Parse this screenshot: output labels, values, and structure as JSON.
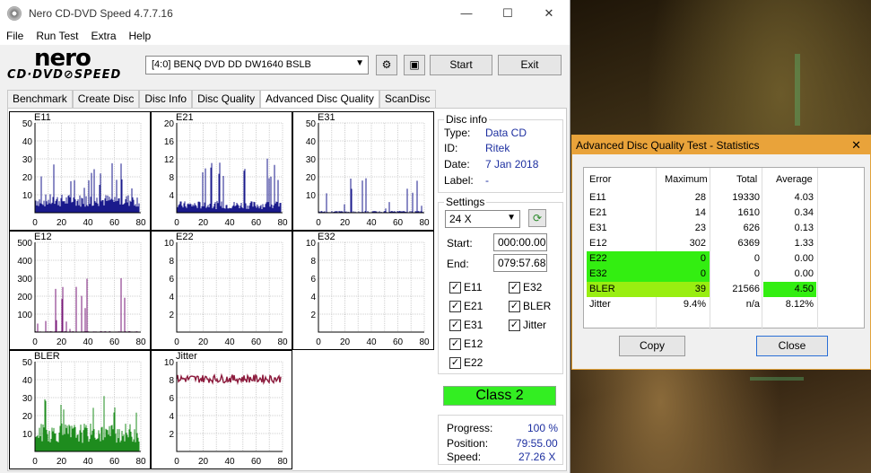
{
  "window": {
    "title": "Nero CD-DVD Speed 4.7.7.16",
    "min": "—",
    "max": "☐",
    "close": "✕"
  },
  "menu": [
    "File",
    "Run Test",
    "Extra",
    "Help"
  ],
  "logo": {
    "line1": "nero",
    "line2": "CD·DVD⊘SPEED"
  },
  "toolbar": {
    "drive": "[4:0]   BENQ DVD DD DW1640 BSLB",
    "start": "Start",
    "exit": "Exit"
  },
  "tabs": [
    "Benchmark",
    "Create Disc",
    "Disc Info",
    "Disc Quality",
    "Advanced Disc Quality",
    "ScanDisc"
  ],
  "disc_info": {
    "heading": "Disc info",
    "rows": [
      {
        "label": "Type:",
        "value": "Data CD"
      },
      {
        "label": "ID:",
        "value": "Ritek"
      },
      {
        "label": "Date:",
        "value": "7 Jan 2018"
      },
      {
        "label": "Label:",
        "value": "-"
      }
    ]
  },
  "settings": {
    "heading": "Settings",
    "speed": "24 X",
    "start_label": "Start:",
    "start": "000:00.00",
    "end_label": "End:",
    "end": "079:57.68",
    "checks": [
      {
        "label": "E11",
        "checked": "✓"
      },
      {
        "label": "E32",
        "checked": "✓"
      },
      {
        "label": "E21",
        "checked": "✓"
      },
      {
        "label": "BLER",
        "checked": "✓"
      },
      {
        "label": "E31",
        "checked": "✓"
      },
      {
        "label": "Jitter",
        "checked": "✓"
      },
      {
        "label": "E12",
        "checked": "✓"
      },
      {
        "label": "E22",
        "checked": "✓"
      }
    ]
  },
  "class_label": "Class 2",
  "progress": {
    "progress_label": "Progress:",
    "progress": "100 %",
    "position_label": "Position:",
    "position": "79:55.00",
    "speed_label": "Speed:",
    "speed": "27.26 X"
  },
  "charts": [
    {
      "name": "E11",
      "yticks": [
        "50",
        "40",
        "30",
        "20",
        "10"
      ],
      "xticks": [
        "0",
        "20",
        "40",
        "60",
        "80"
      ],
      "ymax": 50,
      "color": "#1a1a8c",
      "chart_data": {
        "type": "bar",
        "x": [
          0,
          80
        ],
        "summary_max": 28,
        "typical": 8
      }
    },
    {
      "name": "E21",
      "yticks": [
        "20",
        "16",
        "12",
        "8",
        "4"
      ],
      "xticks": [
        "0",
        "20",
        "40",
        "60",
        "80"
      ],
      "ymax": 20,
      "color": "#1a1a8c",
      "chart_data": {
        "type": "bar",
        "x": [
          0,
          80
        ],
        "summary_max": 14,
        "typical": 2
      }
    },
    {
      "name": "E31",
      "yticks": [
        "50",
        "40",
        "30",
        "20",
        "10"
      ],
      "xticks": [
        "0",
        "20",
        "40",
        "60",
        "80"
      ],
      "ymax": 50,
      "color": "#1a1a8c",
      "chart_data": {
        "type": "bar",
        "x": [
          0,
          80
        ],
        "summary_max": 23,
        "typical": 1
      }
    },
    {
      "name": "E12",
      "yticks": [
        "500",
        "400",
        "300",
        "200",
        "100"
      ],
      "xticks": [
        "0",
        "20",
        "40",
        "60",
        "80"
      ],
      "ymax": 500,
      "color": "#7a1a7a",
      "chart_data": {
        "type": "bar",
        "x": [
          0,
          80
        ],
        "summary_max": 302,
        "typical": 5
      }
    },
    {
      "name": "E22",
      "yticks": [
        "10",
        "8",
        "6",
        "4",
        "2"
      ],
      "xticks": [
        "0",
        "20",
        "40",
        "60",
        "80"
      ],
      "ymax": 10,
      "color": "#1a1a8c",
      "chart_data": {
        "type": "bar",
        "x": [
          0,
          80
        ],
        "summary_max": 0,
        "typical": 0
      }
    },
    {
      "name": "E32",
      "yticks": [
        "10",
        "8",
        "6",
        "4",
        "2"
      ],
      "xticks": [
        "0",
        "20",
        "40",
        "60",
        "80"
      ],
      "ymax": 10,
      "color": "#1a1a8c",
      "chart_data": {
        "type": "bar",
        "x": [
          0,
          80
        ],
        "summary_max": 0,
        "typical": 0
      }
    },
    {
      "name": "BLER",
      "yticks": [
        "50",
        "40",
        "30",
        "20",
        "10"
      ],
      "xticks": [
        "0",
        "20",
        "40",
        "60",
        "80"
      ],
      "ymax": 50,
      "color": "#1e8c1e",
      "chart_data": {
        "type": "bar",
        "x": [
          0,
          80
        ],
        "summary_max": 39,
        "typical": 12
      }
    },
    {
      "name": "Jitter",
      "yticks": [
        "10",
        "8",
        "6",
        "4",
        "2"
      ],
      "xticks": [
        "0",
        "20",
        "40",
        "60",
        "80"
      ],
      "ymax": 10,
      "color": "#8c1a3c",
      "chart_data": {
        "type": "line",
        "x": [
          0,
          80
        ],
        "level": 8.1
      }
    }
  ],
  "dialog": {
    "title": "Advanced Disc Quality Test - Statistics",
    "headers": [
      "Error",
      "Maximum",
      "Total",
      "Average"
    ],
    "rows": [
      [
        "E11",
        "28",
        "19330",
        "4.03"
      ],
      [
        "E21",
        "14",
        "1610",
        "0.34"
      ],
      [
        "E31",
        "23",
        "626",
        "0.13"
      ],
      [
        "E12",
        "302",
        "6369",
        "1.33"
      ],
      [
        "E22",
        "0",
        "0",
        "0.00"
      ],
      [
        "E32",
        "0",
        "0",
        "0.00"
      ],
      [
        "BLER",
        "39",
        "21566",
        "4.50"
      ],
      [
        "Jitter",
        "9.4%",
        "n/a",
        "8.12%"
      ]
    ],
    "copy": "Copy",
    "close": "Close"
  }
}
